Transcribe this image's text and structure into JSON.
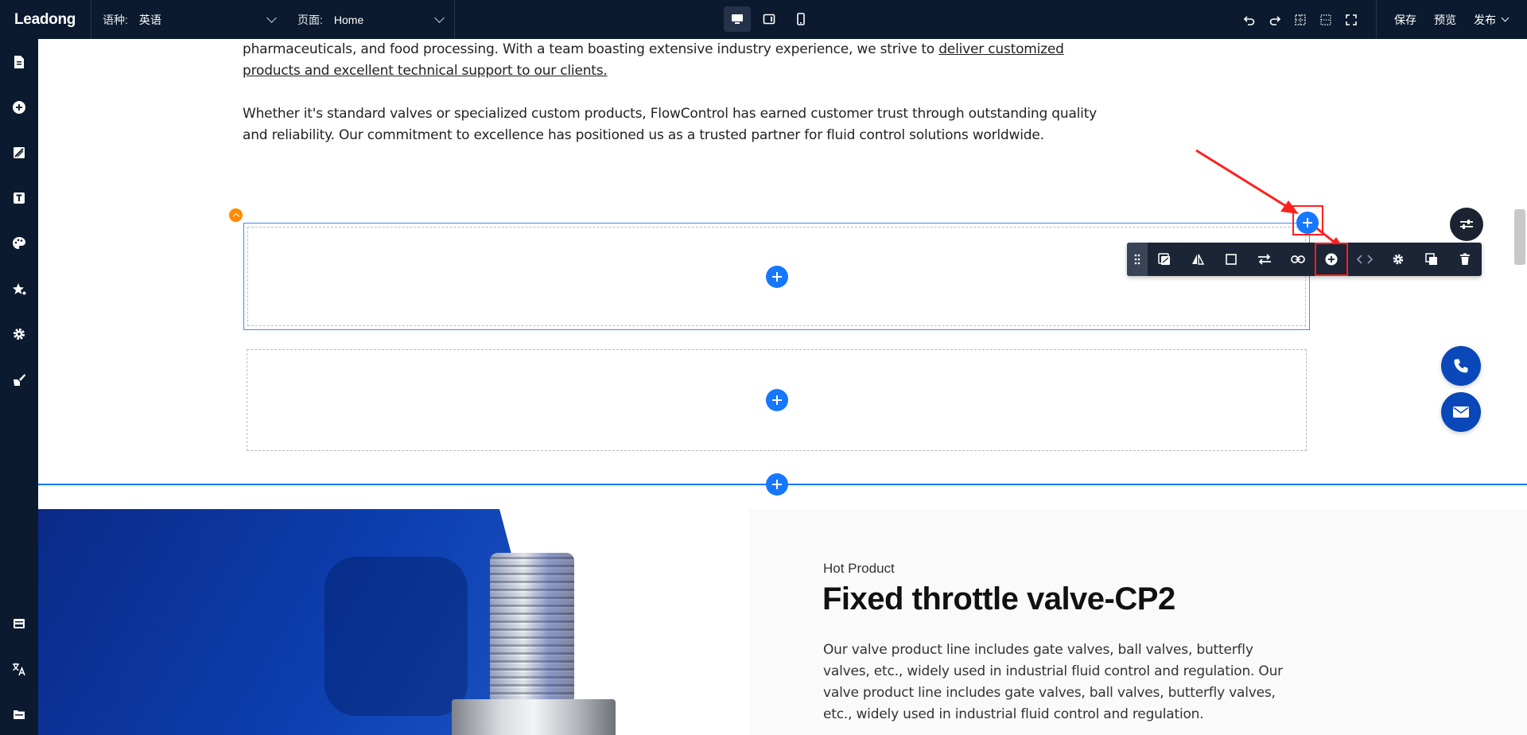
{
  "topbar": {
    "logo": "Leadong",
    "language": {
      "label": "语种:",
      "value": "英语"
    },
    "page": {
      "label": "页面:",
      "value": "Home"
    },
    "save": "保存",
    "preview": "预览",
    "publish": "发布"
  },
  "content": {
    "para1_a": "pharmaceuticals, and food processing. With a team boasting extensive industry experience, we strive to ",
    "para1_link": "deliver customized products and excellent technical support to our clients.",
    "para2": "Whether it's standard valves or specialized custom products, FlowControl has earned customer trust through outstanding quality and reliability. Our commitment to excellence has positioned us as a trusted partner for fluid control solutions worldwide."
  },
  "product": {
    "label": "Hot Product",
    "title": "Fixed throttle valve-CP2",
    "description": "Our valve product line includes gate valves, ball valves, butterfly valves, etc., widely used in industrial fluid control and regulation. Our valve product line includes gate valves, ball valves, butterfly valves, etc., widely used in industrial fluid control and regulation."
  },
  "colors": {
    "accent": "#1677ff",
    "annotation": "#ff2020",
    "topbar_bg": "#0b1a2e",
    "contact_blue": "#0a47b8"
  }
}
